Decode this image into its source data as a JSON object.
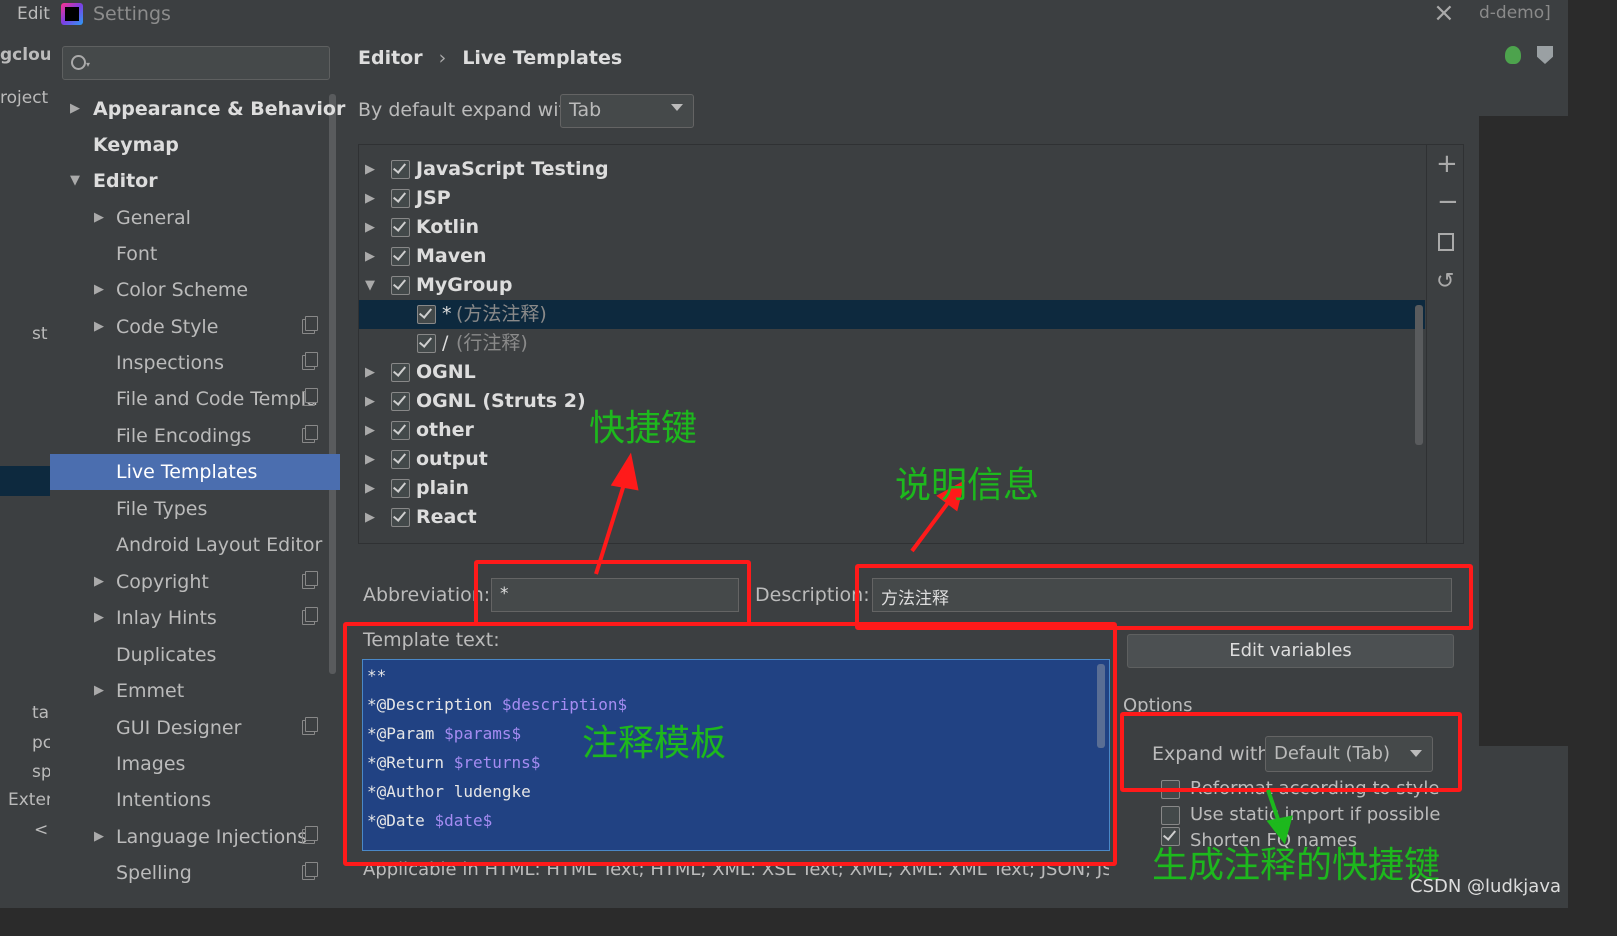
{
  "background": {
    "menu_edit": "Edit",
    "project_name_fragment": "gclou",
    "project_tab": "roject",
    "title_fragment": "d-demo]",
    "left_items": [
      "st",
      "ta",
      "pc",
      "sp",
      "Exter",
      "<"
    ]
  },
  "dialog": {
    "title": "Settings",
    "breadcrumb": {
      "parent": "Editor",
      "sep": "›",
      "current": "Live Templates"
    }
  },
  "search": {
    "placeholder": ""
  },
  "sidebar": {
    "items": [
      {
        "label": "Appearance & Behavior"
      },
      {
        "label": "Keymap"
      },
      {
        "label": "Editor"
      },
      {
        "label": "General"
      },
      {
        "label": "Font"
      },
      {
        "label": "Color Scheme"
      },
      {
        "label": "Code Style"
      },
      {
        "label": "Inspections"
      },
      {
        "label": "File and Code Templa"
      },
      {
        "label": "File Encodings"
      },
      {
        "label": "Live Templates"
      },
      {
        "label": "File Types"
      },
      {
        "label": "Android Layout Editor"
      },
      {
        "label": "Copyright"
      },
      {
        "label": "Inlay Hints"
      },
      {
        "label": "Duplicates"
      },
      {
        "label": "Emmet"
      },
      {
        "label": "GUI Designer"
      },
      {
        "label": "Images"
      },
      {
        "label": "Intentions"
      },
      {
        "label": "Language Injections"
      },
      {
        "label": "Spelling"
      }
    ]
  },
  "expand": {
    "label": "By default expand with",
    "value": "Tab"
  },
  "tree": {
    "groups": [
      {
        "label": "JavaScript Testing"
      },
      {
        "label": "JSP"
      },
      {
        "label": "Kotlin"
      },
      {
        "label": "Maven"
      },
      {
        "label": "MyGroup"
      },
      {
        "label": "OGNL"
      },
      {
        "label": "OGNL (Struts 2)"
      },
      {
        "label": "other"
      },
      {
        "label": "output"
      },
      {
        "label": "plain"
      },
      {
        "label": "React"
      }
    ],
    "children": [
      {
        "key": "*",
        "desc": "(方法注释)"
      },
      {
        "key": "/",
        "desc": "(行注释)"
      }
    ]
  },
  "toolbar": {
    "add": "+",
    "remove": "−"
  },
  "form": {
    "abbreviation_label": "Abbreviation:",
    "abbreviation_value": "*",
    "description_label": "Description:",
    "description_value": "方法注释",
    "template_label": "Template text:",
    "edit_variables": "Edit variables",
    "options_label": "Options",
    "expand_with_label": "Expand with",
    "expand_with_value": "Default (Tab)",
    "reformat": "Reformat according to style",
    "static_import": "Use static import if possible",
    "shorten": "Shorten FQ names",
    "applicable": "Applicable in HTML: HTML Text; HTML; XML: XSL Text; XML; XML: XML Text; JSON; JSON: J"
  },
  "template_lines": [
    {
      "plain": "**",
      "var": ""
    },
    {
      "plain": "*@Description ",
      "var": "$description$"
    },
    {
      "plain": "*@Param ",
      "var": "$params$"
    },
    {
      "plain": "*@Return ",
      "var": "$returns$"
    },
    {
      "plain": "*@Author ludengke",
      "var": ""
    },
    {
      "plain": "*@Date ",
      "var": "$date$"
    }
  ],
  "annotations": {
    "shortcut": "快捷键",
    "description_info": "说明信息",
    "template": "注释模板",
    "gen_shortcut": "生成注释的快捷键"
  },
  "watermark": "CSDN @ludkjava",
  "colors": {
    "annotation": "#1db81d",
    "highlight": "#ff1a1a",
    "selection": "#4b6eaf"
  }
}
